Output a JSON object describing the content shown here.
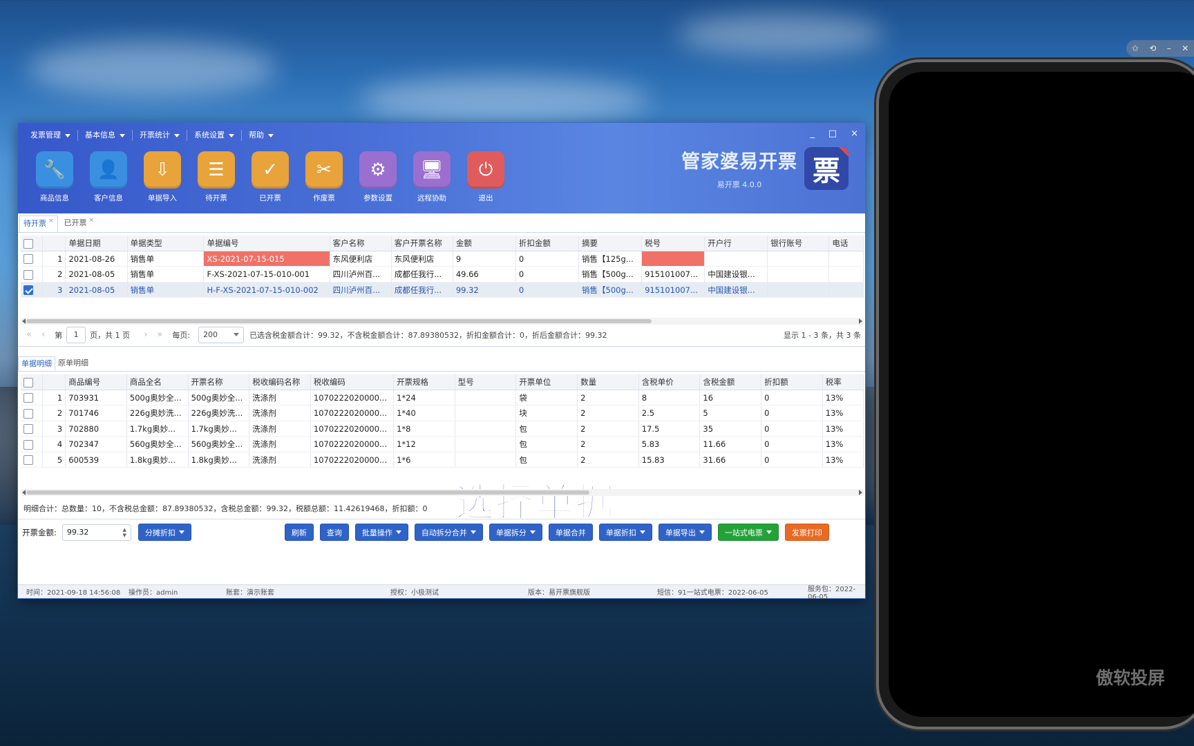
{
  "menu": [
    "发票管理",
    "基本信息",
    "开票统计",
    "系统设置",
    "帮助"
  ],
  "window_controls": [
    "_",
    "□",
    "×"
  ],
  "toolbar": [
    {
      "label": "商品信息",
      "icon": "wrench-icon",
      "color": "#3a8fe0"
    },
    {
      "label": "客户信息",
      "icon": "user-icon",
      "color": "#3a8fe0"
    },
    {
      "label": "单据导入",
      "icon": "import-icon",
      "color": "#e8a33a"
    },
    {
      "label": "待开票",
      "icon": "clipboard-icon",
      "color": "#e8a33a"
    },
    {
      "label": "已开票",
      "icon": "check-icon",
      "color": "#e8a33a"
    },
    {
      "label": "作废票",
      "icon": "void-ticket-icon",
      "color": "#e8a33a"
    },
    {
      "label": "参数设置",
      "icon": "gear-icon",
      "color": "#9b6fd0"
    },
    {
      "label": "远程协助",
      "icon": "monitor-icon",
      "color": "#9b6fd0"
    },
    {
      "label": "退出",
      "icon": "power-icon",
      "color": "#e05c5c"
    }
  ],
  "brand": {
    "title": "管家婆易开票",
    "version": "易开票 4.0.0",
    "logo_char": "票"
  },
  "tabs": [
    "待开票",
    "已开票"
  ],
  "bills": {
    "headers": [
      "单据日期",
      "单据类型",
      "单据编号",
      "客户名称",
      "客户开票名称",
      "金额",
      "折扣金额",
      "摘要",
      "税号",
      "开户行",
      "银行账号",
      "电话"
    ],
    "rows": [
      {
        "no": "1",
        "checked": false,
        "cells": [
          "2021-08-26",
          "销售单",
          "XS-2021-07-15-015",
          "东风便利店",
          "东风便利店",
          "9",
          "0",
          "销售【125g...",
          "",
          "",
          "",
          ""
        ]
      },
      {
        "no": "2",
        "checked": false,
        "cells": [
          "2021-08-05",
          "销售单",
          "F-XS-2021-07-15-010-001",
          "四川泸州百...",
          "成都任我行...",
          "49.66",
          "0",
          "销售【500g...",
          "915101007...",
          "中国建设银...",
          "",
          ""
        ]
      },
      {
        "no": "3",
        "checked": true,
        "cells": [
          "2021-08-05",
          "销售单",
          "H-F-XS-2021-07-15-010-002",
          "四川泸州百...",
          "成都任我行...",
          "99.32",
          "0",
          "销售【500g...",
          "915101007...",
          "中国建设银...",
          "",
          ""
        ]
      }
    ]
  },
  "pager": {
    "first": "«",
    "prev": "‹",
    "page_label_pre": "第",
    "page": "1",
    "page_label_post": "页，共 1 页",
    "next": "›",
    "last": "»",
    "per_page_label": "每页:",
    "per_page": "200",
    "summary": "已选含税金额合计：99.32，不含税金额合计：87.89380532，折扣金额合计：0，折后金额合计：99.32",
    "showing": "显示 1 - 3 条，共 3 条"
  },
  "detail_tabs": [
    "单据明细",
    "原单明细"
  ],
  "details": {
    "headers": [
      "商品编号",
      "商品全名",
      "开票名称",
      "税收编码名称",
      "税收编码",
      "开票规格",
      "型号",
      "开票单位",
      "数量",
      "含税单价",
      "含税金额",
      "折扣额",
      "税率"
    ],
    "rows": [
      {
        "no": "1",
        "cells": [
          "703931",
          "500g奥妙全...",
          "500g奥妙全...",
          "洗涤剂",
          "1070222020000...",
          "1*24",
          "",
          "袋",
          "2",
          "8",
          "16",
          "0",
          "13%"
        ]
      },
      {
        "no": "2",
        "cells": [
          "701746",
          "226g奥妙洗...",
          "226g奥妙洗...",
          "洗涤剂",
          "1070222020000...",
          "1*40",
          "",
          "块",
          "2",
          "2.5",
          "5",
          "0",
          "13%"
        ]
      },
      {
        "no": "3",
        "cells": [
          "702880",
          "1.7kg奥妙...",
          "1.7kg奥妙...",
          "洗涤剂",
          "1070222020000...",
          "1*8",
          "",
          "包",
          "2",
          "17.5",
          "35",
          "0",
          "13%"
        ]
      },
      {
        "no": "4",
        "cells": [
          "702347",
          "560g奥妙全...",
          "560g奥妙全...",
          "洗涤剂",
          "1070222020000...",
          "1*12",
          "",
          "包",
          "2",
          "5.83",
          "11.66",
          "0",
          "13%"
        ]
      },
      {
        "no": "5",
        "cells": [
          "600539",
          "1.8kg奥妙...",
          "1.8kg奥妙...",
          "洗涤剂",
          "1070222020000...",
          "1*6",
          "",
          "包",
          "2",
          "15.83",
          "31.66",
          "0",
          "13%"
        ]
      }
    ]
  },
  "overlay_text": "选择单据",
  "detail_summary": "明细合计：总数量：10，不含税总金额：87.89380532，含税总金额：99.32，税额总额：11.42619468，折扣额：0",
  "actions": {
    "amount_label": "开票金额:",
    "amount": "99.32",
    "buttons": [
      {
        "label": "分摊折扣",
        "drop": true,
        "style": "blue"
      },
      {
        "label": "刷新",
        "drop": false,
        "style": "blue"
      },
      {
        "label": "查询",
        "drop": false,
        "style": "blue"
      },
      {
        "label": "批量操作",
        "drop": true,
        "style": "blue"
      },
      {
        "label": "自动拆分合并",
        "drop": true,
        "style": "blue"
      },
      {
        "label": "单据拆分",
        "drop": true,
        "style": "blue"
      },
      {
        "label": "单据合并",
        "drop": false,
        "style": "blue"
      },
      {
        "label": "单据折扣",
        "drop": true,
        "style": "blue"
      },
      {
        "label": "单据导出",
        "drop": true,
        "style": "blue"
      },
      {
        "label": "一站式电票",
        "drop": true,
        "style": "green"
      },
      {
        "label": "发票打印",
        "drop": false,
        "style": "orange"
      }
    ]
  },
  "status": {
    "time": "时间：2021-09-18 14:56:08",
    "operator": "操作员：admin",
    "account": "账套：演示账套",
    "license": "授权：小极测试",
    "edition": "版本：易开票旗舰版",
    "sms": "短信：91一站式电票：2022-06-05",
    "service": "服务包：2022-06-05"
  },
  "phone_watermark": "傲软投屏"
}
